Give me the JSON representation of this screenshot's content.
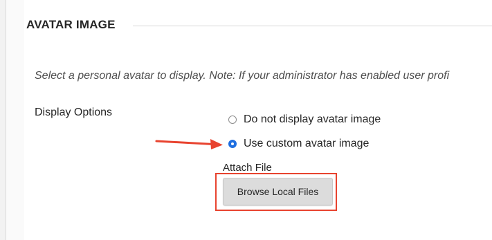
{
  "section": {
    "title": "AVATAR IMAGE"
  },
  "instructions": "Select a personal avatar to display. Note: If your administrator has enabled user profi",
  "display_options": {
    "label": "Display Options",
    "options": [
      {
        "label": "Do not display avatar image",
        "selected": false
      },
      {
        "label": "Use custom avatar image",
        "selected": true
      }
    ]
  },
  "attach": {
    "label": "Attach File",
    "browse_label": "Browse Local Files"
  },
  "colors": {
    "accent": "#1f6fe0",
    "annotation": "#e8432f"
  },
  "annotations": {
    "arrow_icon": "arrow-right-icon"
  }
}
